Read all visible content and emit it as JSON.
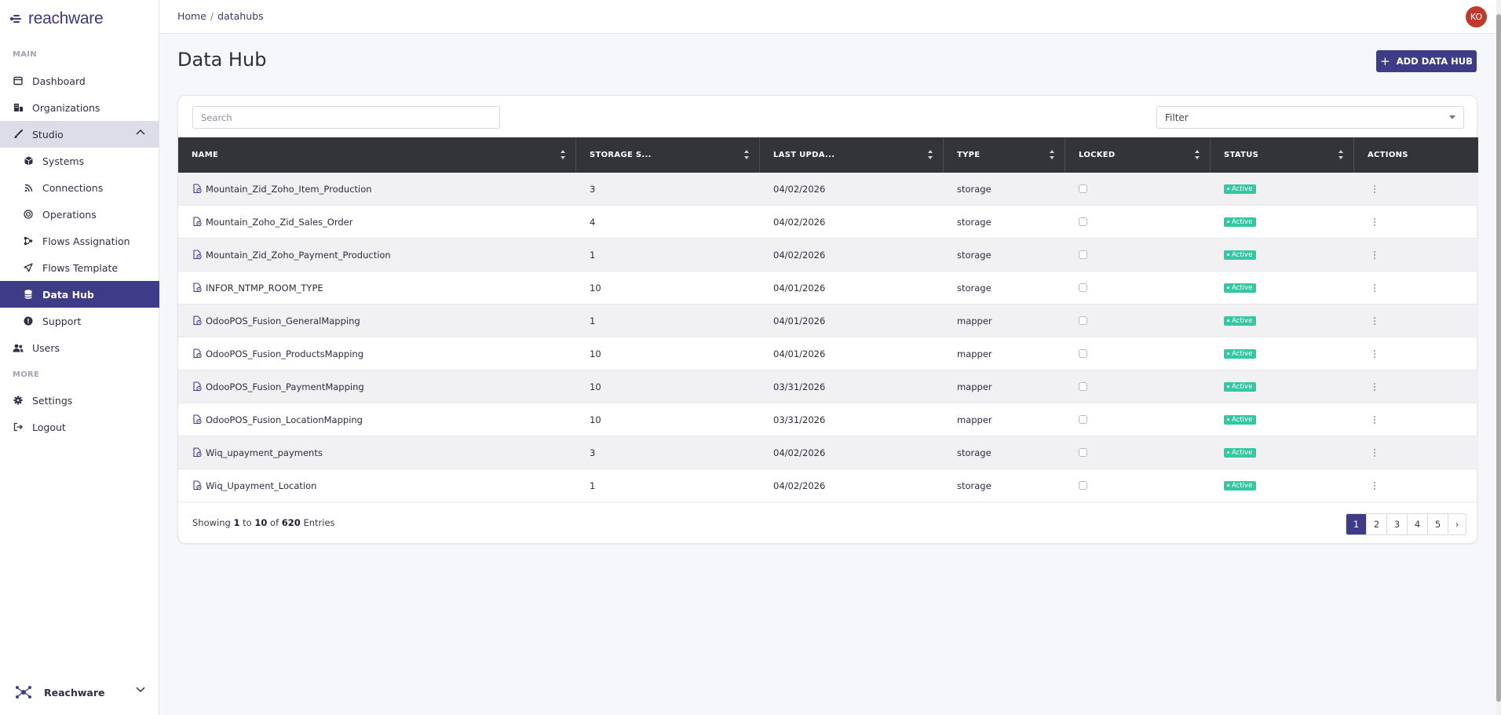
{
  "brand": {
    "logo": "reachware",
    "footer_name": "Reachware"
  },
  "sidebar": {
    "main_label": "MAIN",
    "more_label": "MORE",
    "items": {
      "dashboard": "Dashboard",
      "organizations": "Organizations",
      "studio": "Studio",
      "systems": "Systems",
      "connections": "Connections",
      "operations": "Operations",
      "flows_assignation": "Flows Assignation",
      "flows_template": "Flows Template",
      "data_hub": "Data Hub",
      "support": "Support",
      "users": "Users",
      "settings": "Settings",
      "logout": "Logout"
    }
  },
  "topbar": {
    "breadcrumb_home": "Home",
    "breadcrumb_sep": "/",
    "breadcrumb_current": "datahubs",
    "avatar_initials": "KO"
  },
  "page": {
    "title": "Data Hub",
    "add_button": "ADD DATA HUB",
    "search_placeholder": "Search",
    "filter_label": "Filter"
  },
  "table": {
    "headers": [
      "NAME",
      "STORAGE S...",
      "LAST UPDA...",
      "TYPE",
      "LOCKED",
      "STATUS",
      "ACTIONS"
    ],
    "rows": [
      {
        "name": "Mountain_Zid_Zoho_Item_Production",
        "storage": "3",
        "updated": "04/02/2026",
        "type": "storage",
        "status": "Active"
      },
      {
        "name": "Mountain_Zoho_Zid_Sales_Order",
        "storage": "4",
        "updated": "04/02/2026",
        "type": "storage",
        "status": "Active"
      },
      {
        "name": "Mountain_Zid_Zoho_Payment_Production",
        "storage": "1",
        "updated": "04/02/2026",
        "type": "storage",
        "status": "Active"
      },
      {
        "name": "INFOR_NTMP_ROOM_TYPE",
        "storage": "10",
        "updated": "04/01/2026",
        "type": "storage",
        "status": "Active"
      },
      {
        "name": "OdooPOS_Fusion_GeneralMapping",
        "storage": "1",
        "updated": "04/01/2026",
        "type": "mapper",
        "status": "Active"
      },
      {
        "name": "OdooPOS_Fusion_ProductsMapping",
        "storage": "10",
        "updated": "04/01/2026",
        "type": "mapper",
        "status": "Active"
      },
      {
        "name": "OdooPOS_Fusion_PaymentMapping",
        "storage": "10",
        "updated": "03/31/2026",
        "type": "mapper",
        "status": "Active"
      },
      {
        "name": "OdooPOS_Fusion_LocationMapping",
        "storage": "10",
        "updated": "03/31/2026",
        "type": "mapper",
        "status": "Active"
      },
      {
        "name": "Wiq_upayment_payments",
        "storage": "3",
        "updated": "04/02/2026",
        "type": "storage",
        "status": "Active"
      },
      {
        "name": "Wiq_Upayment_Location",
        "storage": "1",
        "updated": "04/02/2026",
        "type": "storage",
        "status": "Active"
      }
    ]
  },
  "footer": {
    "showing_prefix": "Showing",
    "from": "1",
    "to_word": "to",
    "to": "10",
    "of_word": "of",
    "total": "620",
    "suffix": "Entries",
    "pages": [
      "1",
      "2",
      "3",
      "4",
      "5"
    ],
    "next": "›"
  },
  "colors": {
    "primary": "#3e3c86",
    "active_badge": "#33c7a2",
    "table_header": "#32343a",
    "avatar": "#c0392b"
  }
}
